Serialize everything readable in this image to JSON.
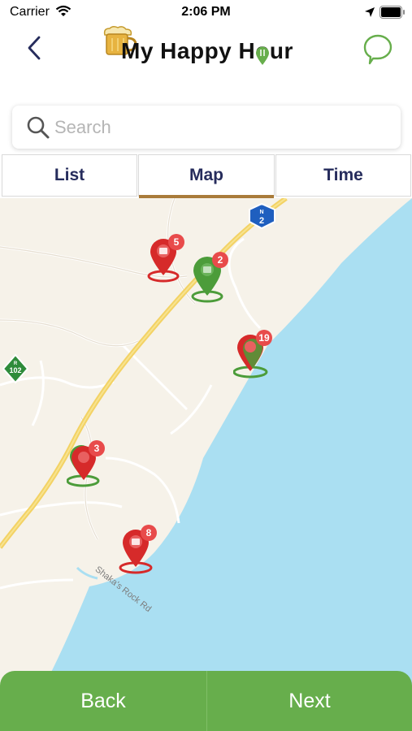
{
  "status_bar": {
    "carrier": "Carrier",
    "time": "2:06 PM",
    "icons": [
      "wifi-icon",
      "location-arrow-icon",
      "battery-icon"
    ]
  },
  "header": {
    "app_title": "My Happy Hour",
    "back_icon": "chevron-left-icon",
    "chat_icon": "chat-bubble-icon"
  },
  "search": {
    "placeholder": "Search",
    "value": ""
  },
  "tabs": [
    {
      "label": "List",
      "selected": false
    },
    {
      "label": "Map",
      "selected": true
    },
    {
      "label": "Time",
      "selected": false
    }
  ],
  "map": {
    "road_name": "Shaka's Rock Rd",
    "route_shields": [
      {
        "label": "N",
        "number": "2",
        "color": "#1f5fbf"
      },
      {
        "label": "R",
        "number": "102",
        "color": "#2e8b3a"
      }
    ],
    "markers": [
      {
        "count": "5",
        "color": "red"
      },
      {
        "count": "2",
        "color": "green"
      },
      {
        "count": "19",
        "color": "red"
      },
      {
        "count": "3",
        "color": "red"
      },
      {
        "count": "8",
        "color": "red"
      }
    ]
  },
  "actions": {
    "back": "Back",
    "next": "Next"
  },
  "colors": {
    "brand_green": "#67ae4c",
    "tab_text": "#262c5c",
    "tab_underline": "#a97b3a",
    "marker_red": "#d62a2a",
    "marker_green": "#4c9c3a",
    "ocean": "#aadff2"
  }
}
